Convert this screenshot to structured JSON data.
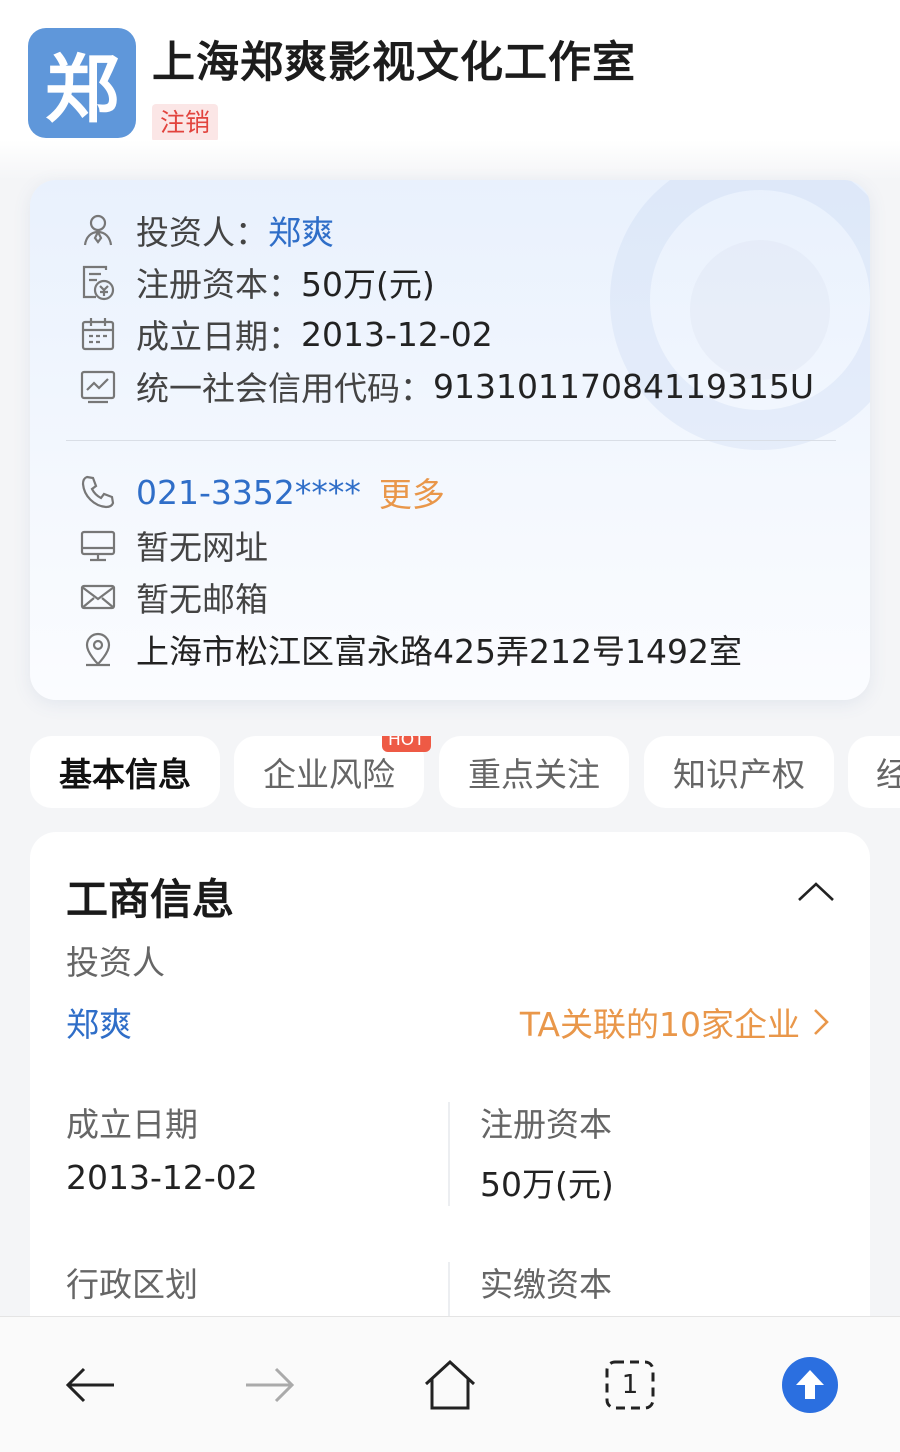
{
  "header": {
    "logo_char": "郑",
    "company_name": "上海郑爽影视文化工作室",
    "status": "注销"
  },
  "info_card": {
    "investor_label": "投资人：",
    "investor_value": "郑爽",
    "capital_label": "注册资本：",
    "capital_value": "50万(元)",
    "founded_label": "成立日期：",
    "founded_value": "2013-12-02",
    "credit_code_label": "统一社会信用代码：",
    "credit_code_value": "91310117084119315U",
    "phone": "021-3352****",
    "phone_more": "更多",
    "website": "暂无网址",
    "email": "暂无邮箱",
    "address": "上海市松江区富永路425弄212号1492室"
  },
  "tabs": [
    {
      "label": "基本信息"
    },
    {
      "label": "企业风险"
    },
    {
      "label": "重点关注"
    },
    {
      "label": "知识产权"
    },
    {
      "label": "经"
    }
  ],
  "hot_badge": "HOT",
  "business": {
    "title": "工商信息",
    "investor_label": "投资人",
    "investor_value": "郑爽",
    "related_link": "TA关联的10家企业",
    "founded_label": "成立日期",
    "founded_value": "2013-12-02",
    "capital_label": "注册资本",
    "capital_value": "50万(元)",
    "region_label": "行政区划",
    "paid_capital_label": "实缴资本"
  },
  "bottom_bar": {
    "tab_count": "1",
    "icons": [
      "back-arrow-icon",
      "forward-arrow-icon",
      "home-icon",
      "tabs-icon",
      "scroll-top-icon"
    ],
    "accent_color": "#2b6fe0"
  }
}
